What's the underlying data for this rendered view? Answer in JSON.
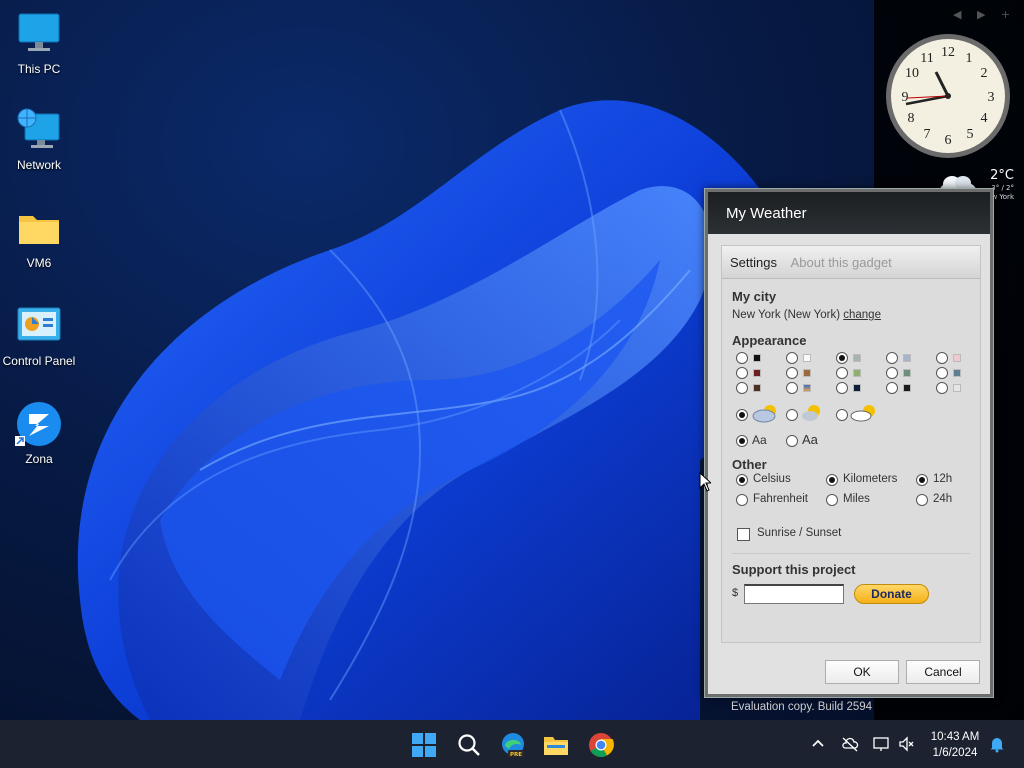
{
  "desktop": {
    "icons": [
      {
        "label": "This PC",
        "icon": "monitor-icon"
      },
      {
        "label": "Network",
        "icon": "network-globe-icon"
      },
      {
        "label": "VM6",
        "icon": "folder-icon"
      },
      {
        "label": "Control Panel",
        "icon": "control-panel-icon"
      },
      {
        "label": "Zona",
        "icon": "zona-app-icon"
      }
    ]
  },
  "sidebar": {
    "nav": "◀ ▶ +",
    "weather": {
      "temp": "2°C",
      "range": "3° / 2°",
      "city": "New York"
    }
  },
  "dialog": {
    "title": "My Weather",
    "tabs": {
      "settings": "Settings",
      "about": "About this gadget"
    },
    "my_city": {
      "heading": "My city",
      "city": "New York (New York)",
      "change": "change"
    },
    "appearance": {
      "heading": "Appearance",
      "font_sample": "Aa"
    },
    "other": {
      "heading": "Other",
      "celsius": "Celsius",
      "fahrenheit": "Fahrenheit",
      "kilometers": "Kilometers",
      "miles": "Miles",
      "h12": "12h",
      "h24": "24h",
      "sunrise": "Sunrise / Sunset"
    },
    "support": {
      "heading": "Support this project",
      "currency": "$",
      "donate": "Donate"
    },
    "buttons": {
      "ok": "OK",
      "cancel": "Cancel"
    }
  },
  "watermark": "Evaluation copy. Build 2594",
  "taskbar": {
    "time": "10:43 AM",
    "date": "1/6/2024",
    "apps": [
      "start-icon",
      "search-icon",
      "edge-beta-icon",
      "file-explorer-icon",
      "chrome-icon"
    ],
    "tray": [
      "chevron-up-icon",
      "cloud-offline-icon",
      "network-icon",
      "volume-muted-icon",
      "notification-bell-icon"
    ]
  }
}
